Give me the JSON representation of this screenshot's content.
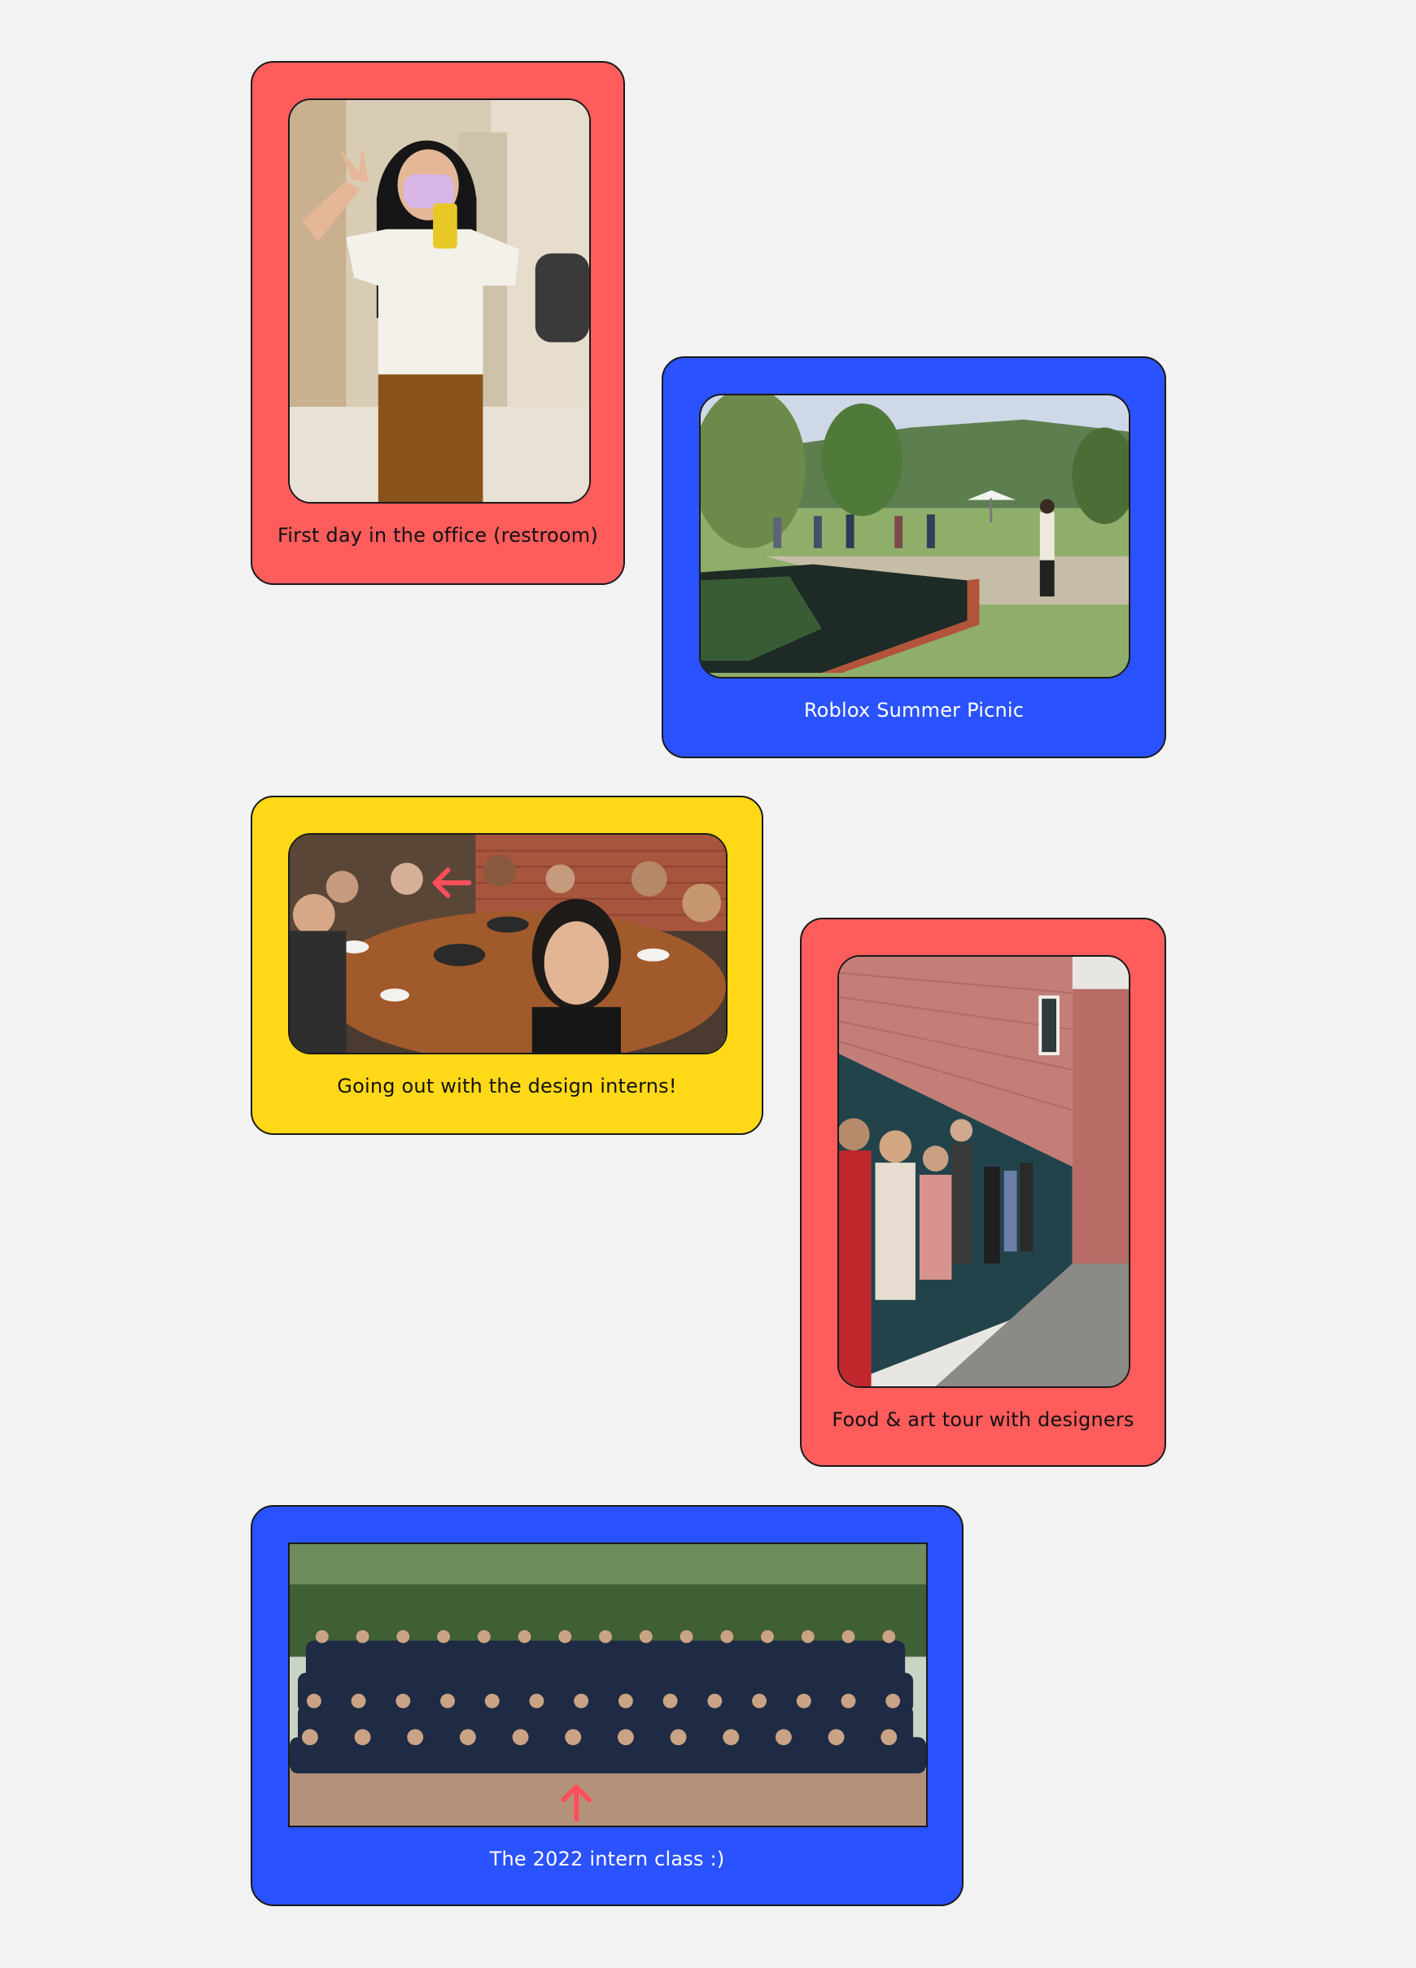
{
  "page": {
    "background": "#f2f2f2"
  },
  "cards": [
    {
      "caption": "First day in the office (restroom)",
      "color": "#ff5c5c",
      "photo_icon": "mirror-selfie-photo"
    },
    {
      "caption": "Roblox Summer Picnic",
      "color": "#2a52ff",
      "photo_icon": "garden-pond-photo"
    },
    {
      "caption": "Going out with the design interns!",
      "color": "#ffd817",
      "photo_icon": "group-dinner-photo"
    },
    {
      "caption": "Food & art tour with designers",
      "color": "#ff5c5c",
      "photo_icon": "street-tour-photo"
    },
    {
      "caption": "The 2022 intern class :)",
      "color": "#2a52ff",
      "photo_icon": "intern-class-group-photo"
    }
  ]
}
